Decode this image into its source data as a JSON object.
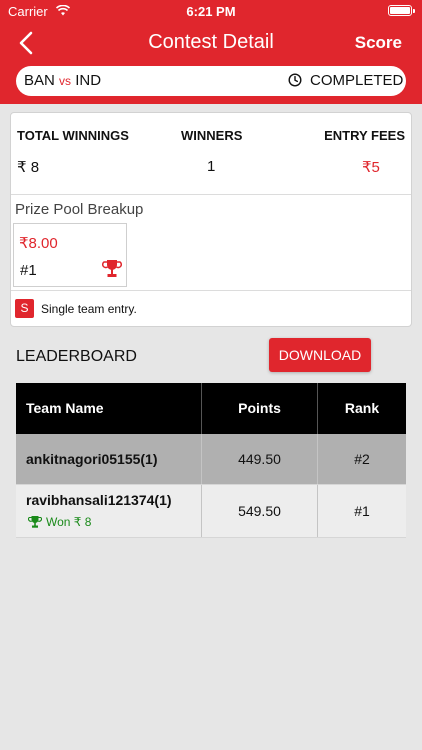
{
  "status_bar": {
    "carrier": "Carrier",
    "time": "6:21 PM"
  },
  "header": {
    "title": "Contest Detail",
    "score_label": "Score",
    "back_icon": "chevron-left-icon"
  },
  "match": {
    "team1": "BAN",
    "vs": "vs",
    "team2": "IND",
    "status": "COMPLETED",
    "status_icon": "clock-icon"
  },
  "summary": {
    "total_winnings_label": "TOTAL WINNINGS",
    "total_winnings_value": "₹ 8",
    "winners_label": "WINNERS",
    "winners_value": "1",
    "entry_fees_label": "ENTRY FEES",
    "entry_fees_value": "₹5"
  },
  "prize_pool": {
    "title": "Prize Pool Breakup",
    "items": [
      {
        "amount": "₹8.00",
        "rank": "#1"
      }
    ]
  },
  "entry": {
    "badge": "S",
    "text": "Single team entry."
  },
  "leaderboard": {
    "title": "LEADERBOARD",
    "download_label": "DOWNLOAD",
    "columns": [
      "Team Name",
      "Points",
      "Rank"
    ],
    "rows": [
      {
        "team": "ankitnagori05155(1)",
        "points": "449.50",
        "rank": "#2",
        "won": ""
      },
      {
        "team": "ravibhansali121374(1)",
        "points": "549.50",
        "rank": "#1",
        "won": "Won ₹ 8"
      }
    ]
  },
  "colors": {
    "accent": "#e0262d",
    "won_green": "#1a8a1a",
    "table_header": "#000000"
  }
}
